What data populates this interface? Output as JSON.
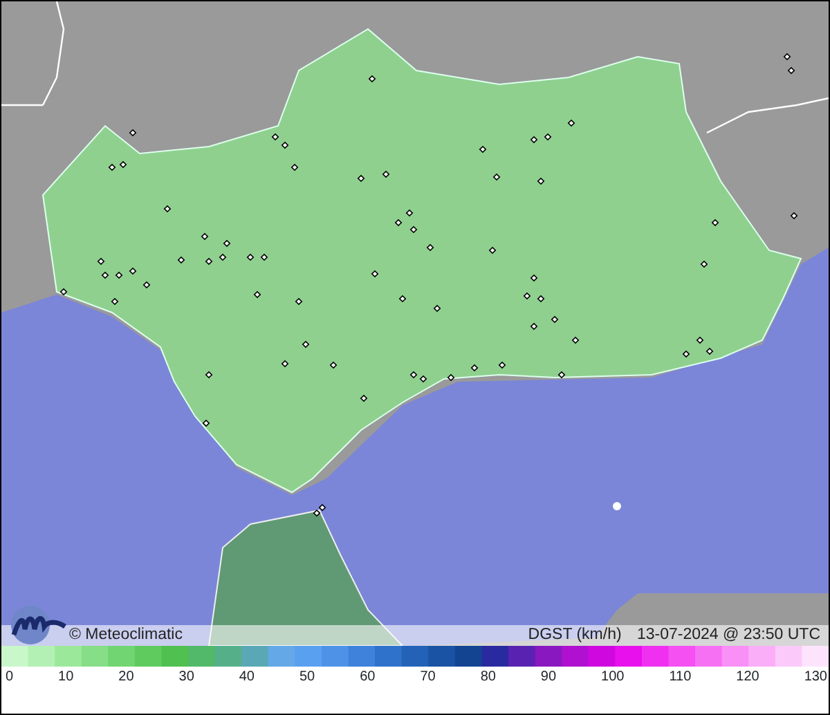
{
  "map": {
    "credit": "© Meteoclimatic",
    "variable": "DGST (km/h)",
    "timestamp": "13-07-2024 @ 23:50 UTC"
  },
  "legend": {
    "ticks": [
      "0",
      "10",
      "20",
      "30",
      "40",
      "50",
      "60",
      "70",
      "80",
      "90",
      "100",
      "110",
      "120",
      "130"
    ]
  }
}
